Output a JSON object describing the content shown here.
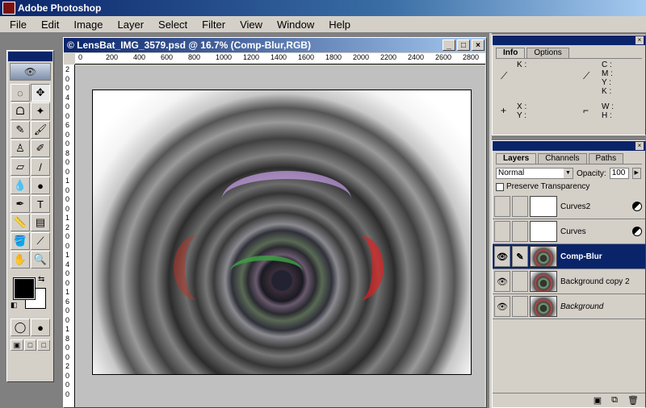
{
  "app": {
    "title": "Adobe Photoshop",
    "icon": "photoshop-icon"
  },
  "menu": [
    "File",
    "Edit",
    "Image",
    "Layer",
    "Select",
    "Filter",
    "View",
    "Window",
    "Help"
  ],
  "document": {
    "title": "© LensBat_IMG_3579.psd @ 16.7% (Comp-Blur,RGB)",
    "window_buttons": {
      "minimize": "_",
      "maximize": "□",
      "close": "×"
    },
    "ruler_h": [
      "0",
      "200",
      "400",
      "600",
      "800",
      "1000",
      "1200",
      "1400",
      "1600",
      "1800",
      "2000",
      "2200",
      "2400",
      "2600",
      "2800"
    ],
    "ruler_v": [
      "2",
      "0",
      "0",
      "4",
      "0",
      "0",
      "6",
      "0",
      "0",
      "8",
      "0",
      "0",
      "1",
      "0",
      "0",
      "0",
      "1",
      "2",
      "0",
      "0",
      "1",
      "4",
      "0",
      "0",
      "1",
      "6",
      "0",
      "0",
      "1",
      "8",
      "0",
      "0",
      "2",
      "0",
      "0",
      "0"
    ]
  },
  "toolbox": {
    "tools": [
      {
        "name": "marquee-tool",
        "glyph": "◌"
      },
      {
        "name": "move-tool",
        "glyph": "✥"
      },
      {
        "name": "lasso-tool",
        "glyph": "ᗝ"
      },
      {
        "name": "magic-wand-tool",
        "glyph": "✦"
      },
      {
        "name": "airbrush-tool",
        "glyph": "✎"
      },
      {
        "name": "paintbrush-tool",
        "glyph": "🖌"
      },
      {
        "name": "clone-stamp-tool",
        "glyph": "♙"
      },
      {
        "name": "history-brush-tool",
        "glyph": "✐"
      },
      {
        "name": "eraser-tool",
        "glyph": "▱"
      },
      {
        "name": "pencil-tool",
        "glyph": "/"
      },
      {
        "name": "blur-tool",
        "glyph": "💧"
      },
      {
        "name": "burn-tool",
        "glyph": "●"
      },
      {
        "name": "pen-tool",
        "glyph": "✒"
      },
      {
        "name": "type-tool",
        "glyph": "T"
      },
      {
        "name": "measure-tool",
        "glyph": "📏"
      },
      {
        "name": "gradient-tool",
        "glyph": "▤"
      },
      {
        "name": "paint-bucket-tool",
        "glyph": "🪣"
      },
      {
        "name": "eyedropper-tool",
        "glyph": "⟋"
      },
      {
        "name": "hand-tool",
        "glyph": "✋"
      },
      {
        "name": "zoom-tool",
        "glyph": "🔍"
      }
    ],
    "foreground_color": "#000000",
    "background_color": "#ffffff"
  },
  "info_panel": {
    "tabs": [
      "Info",
      "Options"
    ],
    "labels": {
      "k": "K :",
      "c": "C :",
      "m": "M :",
      "y_cmyk": "Y :",
      "k2": "K :",
      "x": "X :",
      "y": "Y :",
      "w": "W :",
      "h": "H :"
    }
  },
  "layers_panel": {
    "tabs": [
      "Layers",
      "Channels",
      "Paths"
    ],
    "blend_mode": "Normal",
    "opacity_label": "Opacity:",
    "opacity_value": "100",
    "preserve_label": "Preserve Transparency",
    "layers": [
      {
        "name": "Curves2",
        "visible": false,
        "active": false,
        "italic": false,
        "kind": "adjustment"
      },
      {
        "name": "Curves",
        "visible": false,
        "active": false,
        "italic": false,
        "kind": "adjustment"
      },
      {
        "name": "Comp-Blur",
        "visible": true,
        "active": true,
        "italic": false,
        "kind": "image"
      },
      {
        "name": "Background copy 2",
        "visible": true,
        "active": false,
        "italic": false,
        "kind": "image"
      },
      {
        "name": "Background",
        "visible": true,
        "active": false,
        "italic": true,
        "kind": "image"
      }
    ]
  }
}
